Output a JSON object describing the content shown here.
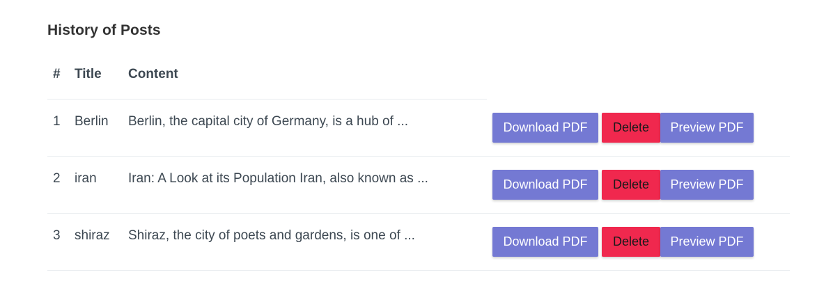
{
  "heading": "History of Posts",
  "columns": {
    "num": "#",
    "title": "Title",
    "content": "Content"
  },
  "rows": [
    {
      "num": "1",
      "title": "Berlin",
      "content": "Berlin, the capital city of Germany, is a hub of ...",
      "download_label": "Download PDF",
      "delete_label": "Delete",
      "preview_label": "Preview PDF"
    },
    {
      "num": "2",
      "title": "iran",
      "content": "Iran: A Look at its Population Iran, also known as ...",
      "download_label": "Download PDF",
      "delete_label": "Delete",
      "preview_label": "Preview PDF"
    },
    {
      "num": "3",
      "title": "shiraz",
      "content": "Shiraz, the city of poets and gardens, is one of ...",
      "download_label": "Download PDF",
      "delete_label": "Delete",
      "preview_label": "Preview PDF"
    }
  ],
  "colors": {
    "primary_button": "#7479d3",
    "danger_button": "#f0284e",
    "text": "#3d4852",
    "divider": "#e8ecef"
  }
}
